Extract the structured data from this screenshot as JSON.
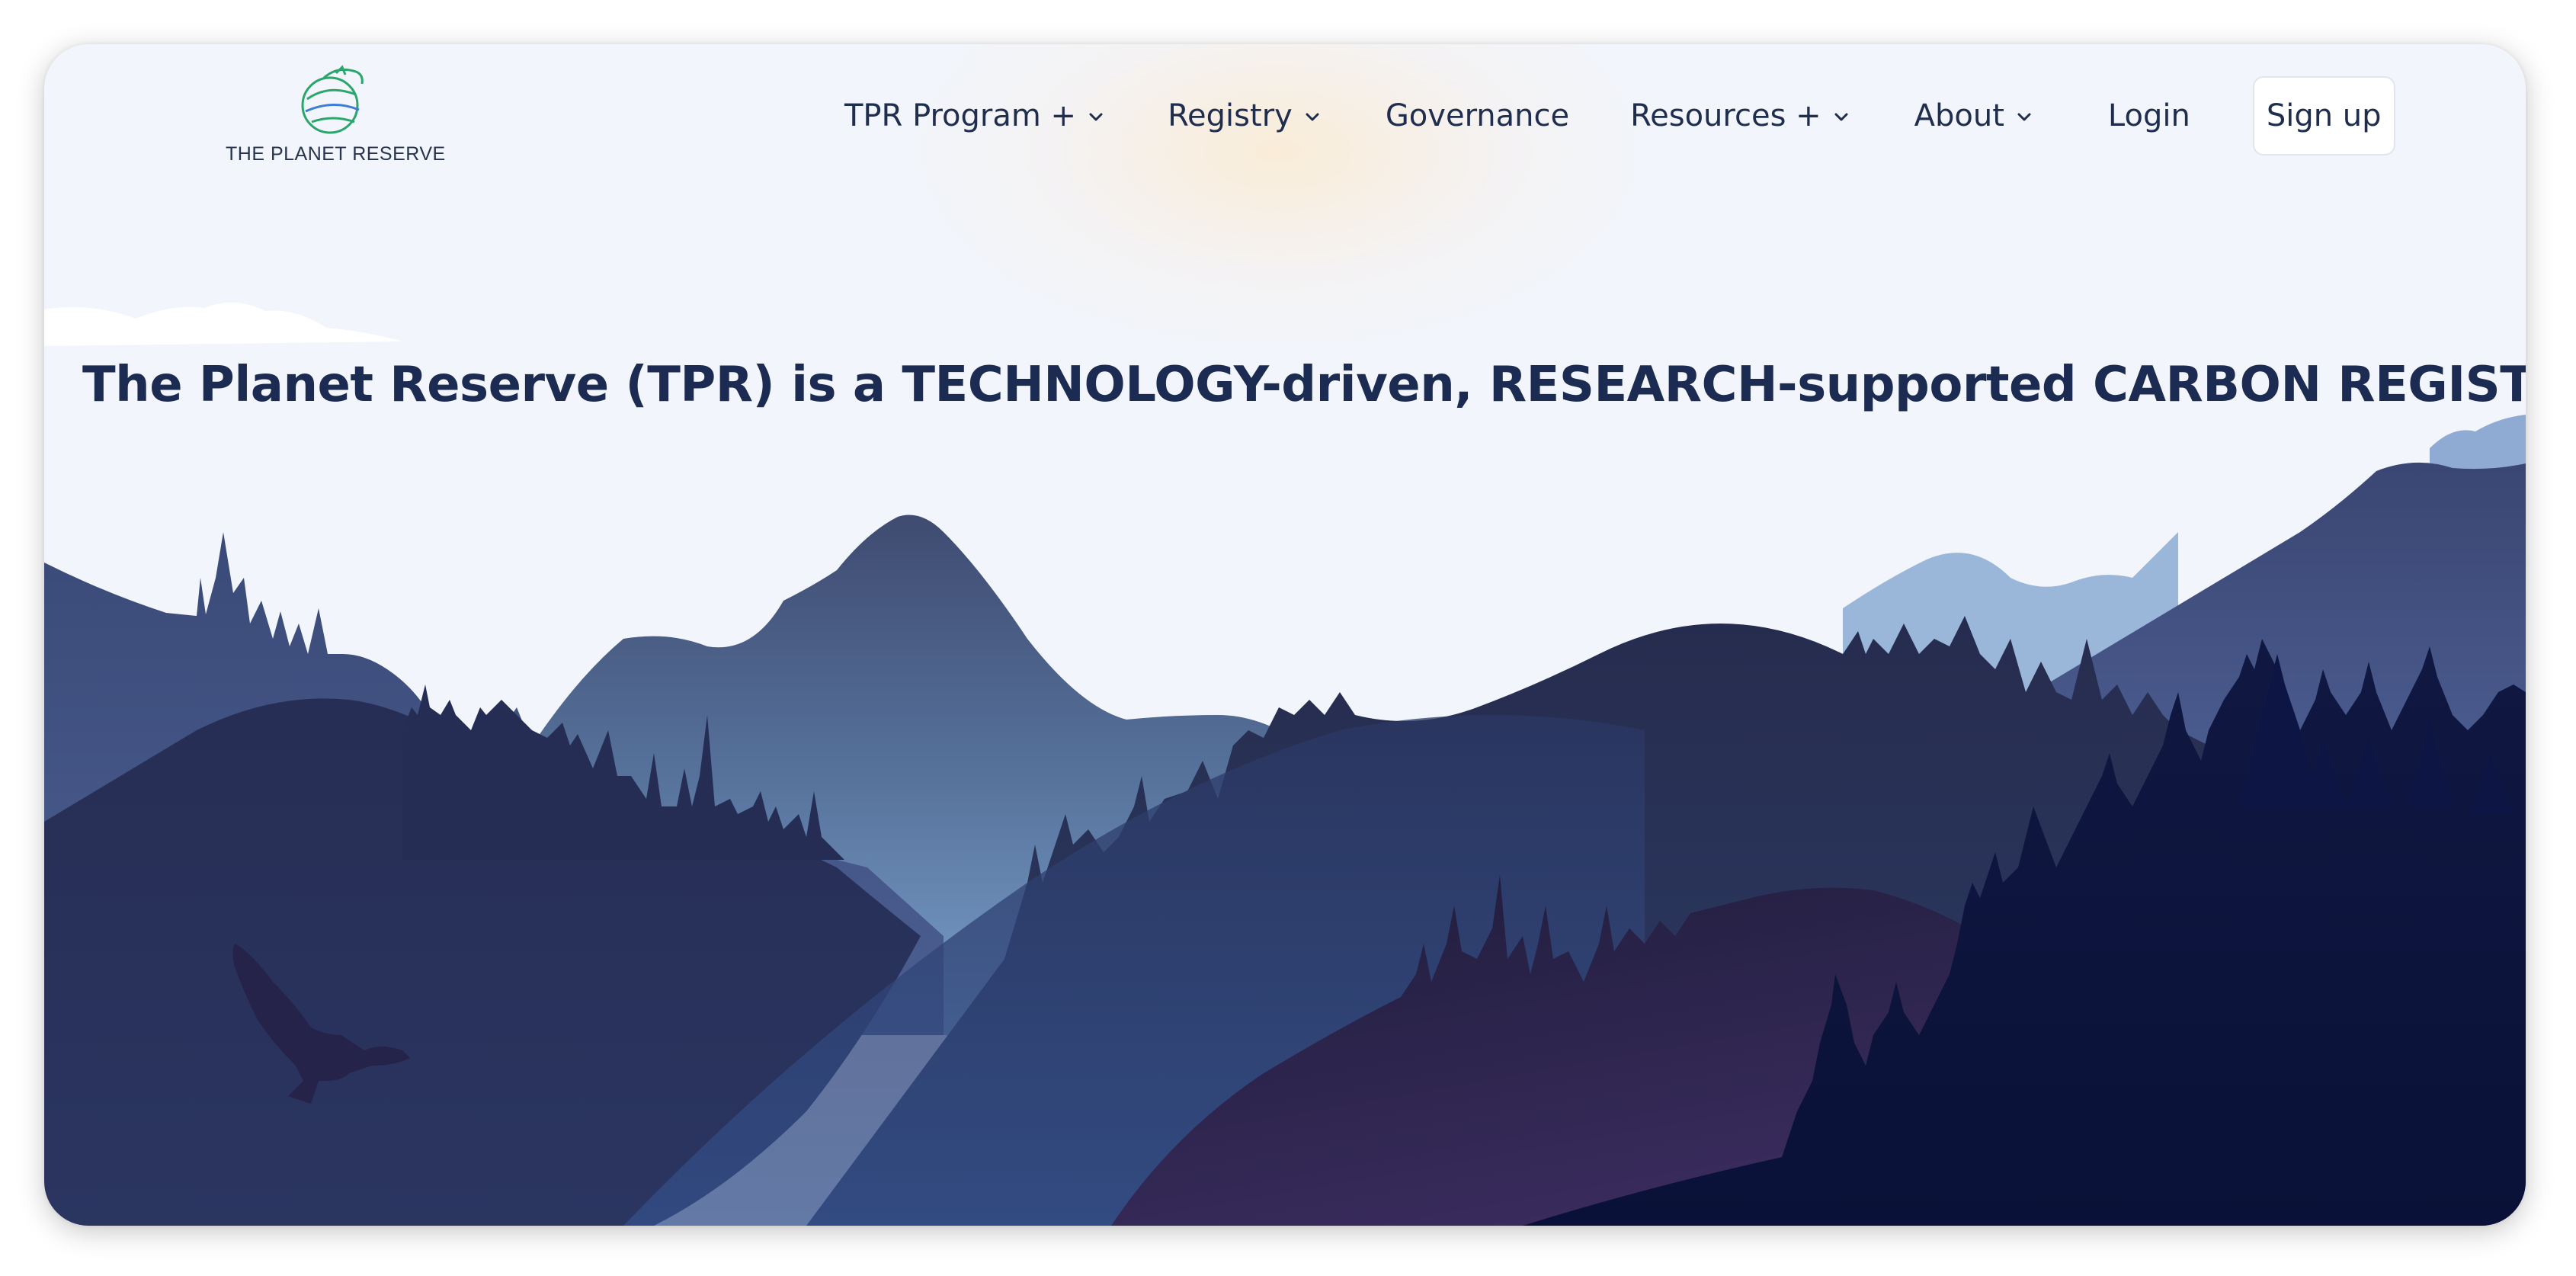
{
  "brand": {
    "name": "THE PLANET RESERVE",
    "logo_icon": "globe-swirl-logo-icon",
    "logo_color": "#2aa66b"
  },
  "nav": {
    "items": [
      {
        "label": "TPR Program +",
        "has_dropdown": true
      },
      {
        "label": "Registry",
        "has_dropdown": true
      },
      {
        "label": "Governance",
        "has_dropdown": false
      },
      {
        "label": "Resources +",
        "has_dropdown": true
      },
      {
        "label": "About",
        "has_dropdown": true
      },
      {
        "label": "Login",
        "has_dropdown": false
      }
    ],
    "signup_label": "Sign up",
    "chevron_icon": "chevron-down-icon"
  },
  "hero": {
    "headline": "The Planet Reserve (TPR) is a TECHNOLOGY-driven, RESEARCH-supported CARBON REGISTRY.",
    "illustration": "mountain-landscape-with-eagle",
    "colors": {
      "sky": "#f2f5fb",
      "headline": "#1c2b52",
      "distant_mountains": "#9ab7da",
      "mid_mountains": "#3d4a72",
      "dark_forest": "#0c1340"
    }
  }
}
